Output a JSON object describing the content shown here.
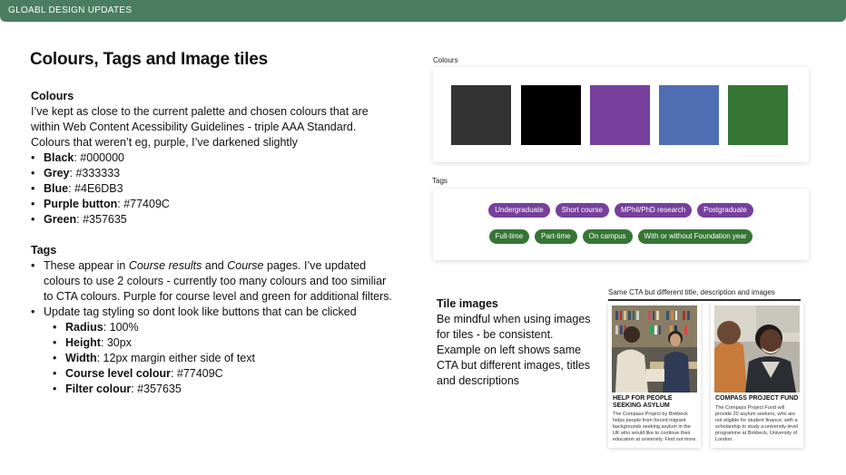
{
  "topbar": {
    "title": "GLOABL DESIGN UPDATES"
  },
  "page_title": "Colours, Tags and Image tiles",
  "colours_section": {
    "heading": "Colours",
    "intro": "I’ve kept as close to the current palette and chosen colours that are within Web Content Acessibility Guidelines - triple AAA Standard. Colours that weren’t eg, purple, I’ve darkened slightly",
    "items": [
      {
        "label": "Black",
        "value": ": #000000"
      },
      {
        "label": "Grey",
        "value": ": #333333"
      },
      {
        "label": "Blue",
        "value": ": #4E6DB3"
      },
      {
        "label": "Purple button",
        "value": ": #77409C"
      },
      {
        "label": "Green",
        "value": ": #357635"
      }
    ]
  },
  "tags_section": {
    "heading": "Tags",
    "bullet1_pre": "These appear in ",
    "bullet1_em1": "Course results",
    "bullet1_mid": " and ",
    "bullet1_em2": "Course",
    "bullet1_post": " pages. I’ve updated colours to use 2 colours - currently too many colours and too similiar to CTA colours. Purple for course level and green for additional filters.",
    "bullet2": "Update tag styling so dont look like buttons that can be clicked",
    "specs": [
      {
        "label": "Radius",
        "value": ": 100%"
      },
      {
        "label": "Height",
        "value": ": 30px"
      },
      {
        "label": "Width",
        "value": ": 12px margin either side of text"
      },
      {
        "label": "Course level colour",
        "value": ": #77409C"
      },
      {
        "label": "Filter colour",
        "value": ": #357635"
      }
    ]
  },
  "colours_panel": {
    "label": "Colours",
    "swatches": [
      "#333333",
      "#000000",
      "#77409C",
      "#4E6DB3",
      "#357635"
    ]
  },
  "tags_panel": {
    "label": "Tags",
    "purple_tags": [
      "Undergraduate",
      "Short course",
      "MPhil/PhD research",
      "Postgraduate"
    ],
    "green_tags": [
      "Full-time",
      "Part-time",
      "On campus",
      "With or without Foundation year"
    ],
    "purple": "#77409C",
    "green": "#357635"
  },
  "tile_images": {
    "heading": "Tile images",
    "body": "Be mindful when using images for tiles - be consistent. Example on left shows same CTA but different images, titles and descriptions"
  },
  "tiles_caption": "Same CTA but different title, description and images",
  "tiles": [
    {
      "title": "HELP FOR PEOPLE SEEKING ASYLUM",
      "body": "The Compass Project by Birkbeck helps people from forced migrant backgrounds seeking asylum in the UK who would like to continue their education at university. Find out more."
    },
    {
      "title": "COMPASS PROJECT FUND",
      "body": "The Compass Project Fund will provide 20 asylum seekers, who are not eligible for student finance, with a scholarship to study a university-level programme at Birkbeck, University of London."
    }
  ]
}
